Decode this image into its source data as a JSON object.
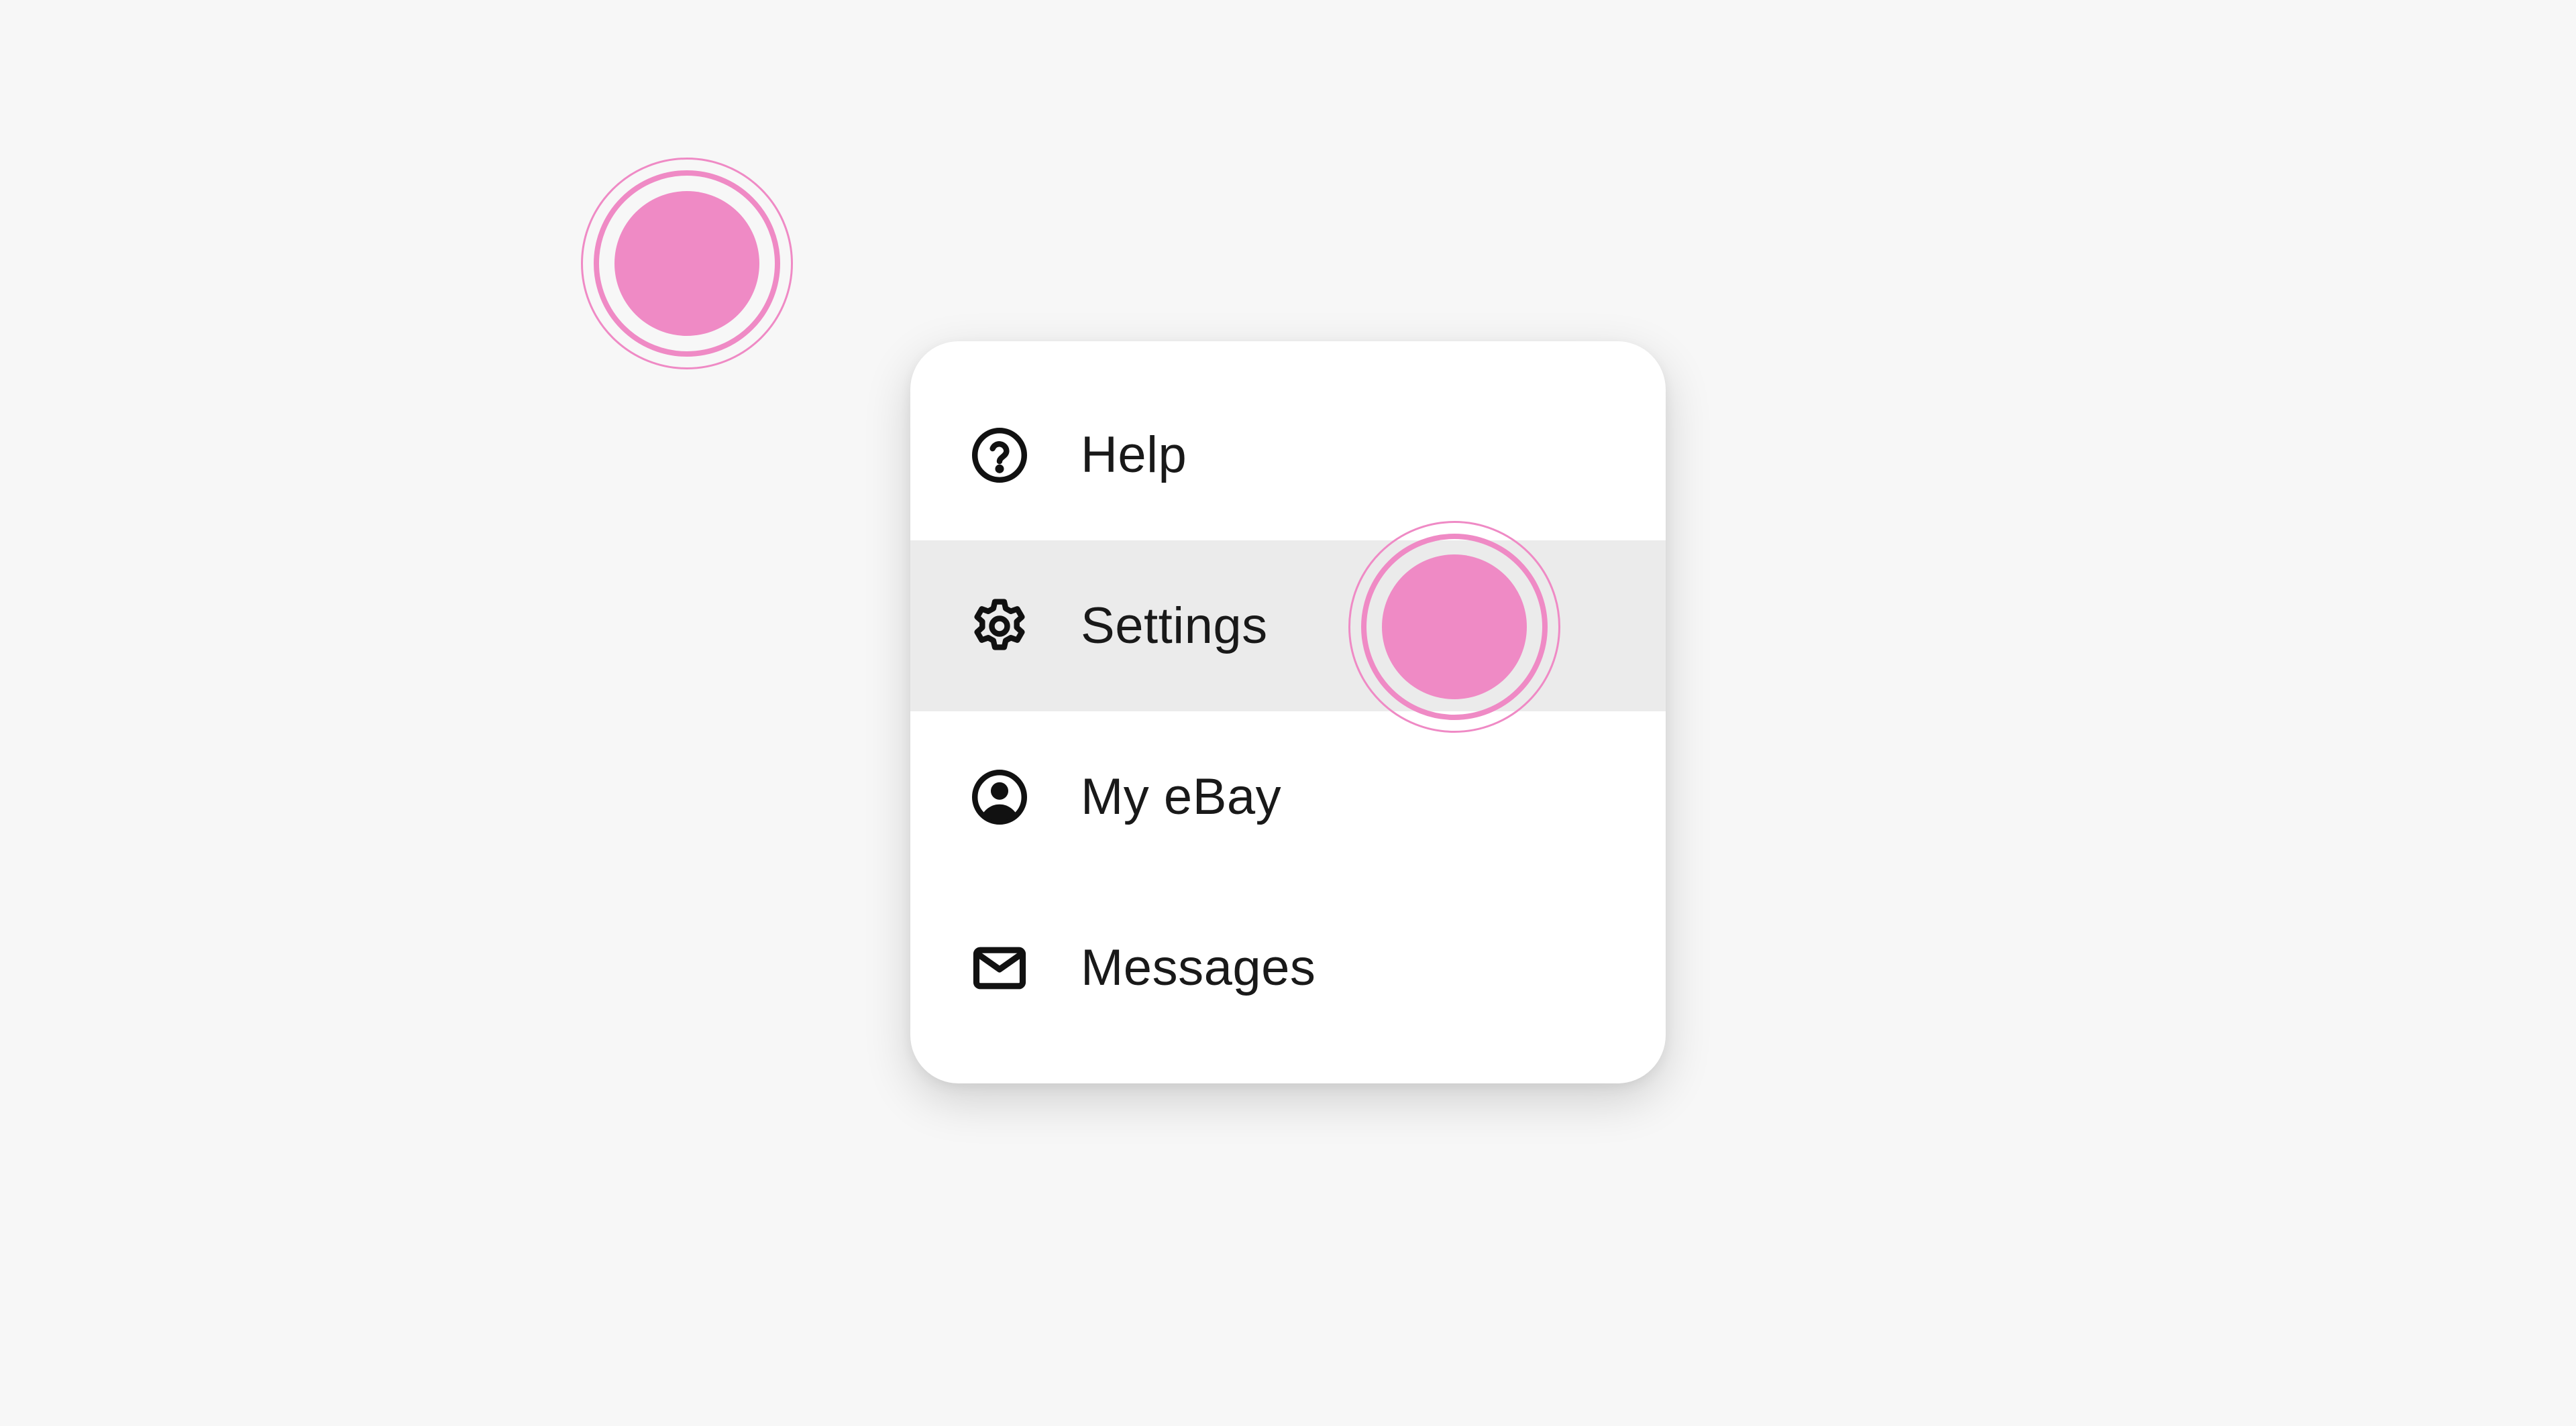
{
  "menu": {
    "items": [
      {
        "label": "Help",
        "icon": "help-circle-icon"
      },
      {
        "label": "Settings",
        "icon": "gear-icon",
        "hovered": true
      },
      {
        "label": "My eBay",
        "icon": "user-circle-icon"
      },
      {
        "label": "Messages",
        "icon": "envelope-icon"
      }
    ]
  },
  "colors": {
    "background": "#f7f7f7",
    "menu_background": "#ffffff",
    "hover_background": "#ebebeb",
    "text": "#191919",
    "touch_indicator": "#ef8ac5"
  }
}
